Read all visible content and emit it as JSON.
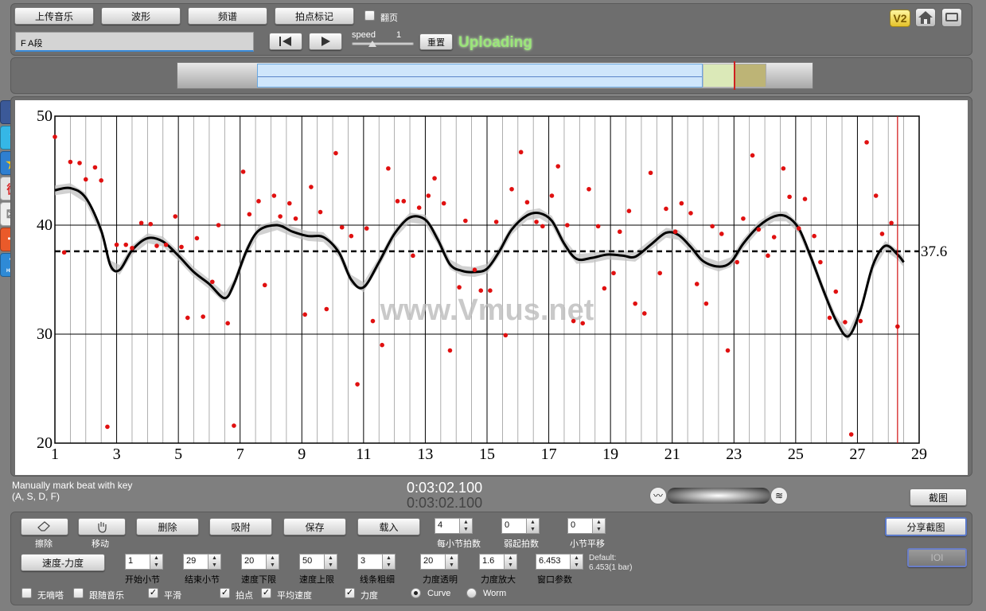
{
  "toolbar": {
    "upload_music": "上传音乐",
    "waveform": "波形",
    "spectrum": "频谱",
    "tap_marker": "拍点标记",
    "flip_page": "翻页",
    "segment_name": "F A段",
    "speed_label": "speed",
    "speed_value": "1",
    "reset": "重置",
    "status": "Uploading",
    "v2_badge": "V2"
  },
  "social": [
    "f",
    "t",
    "★",
    "微",
    "✉",
    "+",
    "?"
  ],
  "social_help": "HELP",
  "chart_data": {
    "type": "scatter",
    "x_ticks": [
      "1",
      "3",
      "5",
      "7",
      "9",
      "11",
      "13",
      "15",
      "17",
      "19",
      "21",
      "23",
      "25",
      "27",
      "29"
    ],
    "y_ticks": [
      "20",
      "30",
      "40",
      "50"
    ],
    "xlim": [
      1,
      29
    ],
    "ylim": [
      20,
      50
    ],
    "mean_line": 37.6,
    "mean_label": "37.6",
    "cursor_x": 28.3,
    "watermark": "www.Vmus.net",
    "points": [
      [
        1.0,
        48.1
      ],
      [
        1.3,
        37.5
      ],
      [
        1.5,
        45.8
      ],
      [
        1.8,
        45.7
      ],
      [
        2.0,
        44.2
      ],
      [
        2.3,
        45.3
      ],
      [
        2.5,
        44.1
      ],
      [
        2.7,
        21.5
      ],
      [
        3.0,
        38.2
      ],
      [
        3.3,
        38.2
      ],
      [
        3.5,
        37.9
      ],
      [
        3.8,
        40.2
      ],
      [
        4.1,
        40.1
      ],
      [
        4.3,
        38.1
      ],
      [
        4.6,
        38.2
      ],
      [
        4.9,
        40.8
      ],
      [
        5.1,
        38.0
      ],
      [
        5.3,
        31.5
      ],
      [
        5.6,
        38.8
      ],
      [
        5.8,
        31.6
      ],
      [
        6.1,
        34.8
      ],
      [
        6.3,
        40.0
      ],
      [
        6.6,
        31.0
      ],
      [
        6.8,
        21.6
      ],
      [
        7.1,
        44.9
      ],
      [
        7.3,
        41.0
      ],
      [
        7.6,
        42.2
      ],
      [
        7.8,
        34.5
      ],
      [
        8.1,
        42.7
      ],
      [
        8.3,
        40.8
      ],
      [
        8.6,
        42.0
      ],
      [
        8.8,
        40.6
      ],
      [
        9.1,
        31.8
      ],
      [
        9.3,
        43.5
      ],
      [
        9.6,
        41.2
      ],
      [
        9.8,
        32.3
      ],
      [
        10.1,
        46.6
      ],
      [
        10.3,
        39.8
      ],
      [
        10.6,
        39.0
      ],
      [
        10.8,
        25.4
      ],
      [
        11.1,
        39.7
      ],
      [
        11.3,
        31.2
      ],
      [
        11.6,
        29.0
      ],
      [
        11.8,
        45.2
      ],
      [
        12.1,
        42.2
      ],
      [
        12.3,
        42.2
      ],
      [
        12.6,
        37.2
      ],
      [
        12.8,
        41.6
      ],
      [
        13.1,
        42.7
      ],
      [
        13.3,
        44.3
      ],
      [
        13.6,
        42.0
      ],
      [
        13.8,
        28.5
      ],
      [
        14.1,
        34.3
      ],
      [
        14.3,
        40.4
      ],
      [
        14.6,
        35.9
      ],
      [
        14.8,
        34.0
      ],
      [
        15.1,
        34.0
      ],
      [
        15.3,
        40.3
      ],
      [
        15.6,
        29.9
      ],
      [
        15.8,
        43.3
      ],
      [
        16.1,
        46.7
      ],
      [
        16.3,
        42.1
      ],
      [
        16.6,
        40.3
      ],
      [
        16.8,
        39.9
      ],
      [
        17.1,
        42.7
      ],
      [
        17.3,
        45.4
      ],
      [
        17.6,
        40.0
      ],
      [
        17.8,
        31.2
      ],
      [
        18.1,
        31.0
      ],
      [
        18.3,
        43.3
      ],
      [
        18.6,
        39.9
      ],
      [
        18.8,
        34.2
      ],
      [
        19.1,
        35.6
      ],
      [
        19.3,
        39.4
      ],
      [
        19.6,
        41.3
      ],
      [
        19.8,
        32.8
      ],
      [
        20.1,
        31.9
      ],
      [
        20.3,
        44.8
      ],
      [
        20.6,
        35.6
      ],
      [
        20.8,
        41.5
      ],
      [
        21.1,
        39.4
      ],
      [
        21.3,
        42.0
      ],
      [
        21.6,
        41.1
      ],
      [
        21.8,
        34.6
      ],
      [
        22.1,
        32.8
      ],
      [
        22.3,
        39.9
      ],
      [
        22.6,
        39.2
      ],
      [
        22.8,
        28.5
      ],
      [
        23.1,
        36.6
      ],
      [
        23.3,
        40.6
      ],
      [
        23.6,
        46.4
      ],
      [
        23.8,
        39.6
      ],
      [
        24.1,
        37.2
      ],
      [
        24.3,
        38.9
      ],
      [
        24.6,
        45.2
      ],
      [
        24.8,
        42.6
      ],
      [
        25.1,
        39.7
      ],
      [
        25.3,
        42.4
      ],
      [
        25.6,
        39.0
      ],
      [
        25.8,
        36.6
      ],
      [
        26.1,
        31.5
      ],
      [
        26.3,
        33.9
      ],
      [
        26.6,
        31.1
      ],
      [
        26.8,
        20.8
      ],
      [
        27.1,
        31.2
      ],
      [
        27.3,
        47.6
      ],
      [
        27.6,
        42.7
      ],
      [
        27.8,
        39.2
      ],
      [
        28.1,
        40.2
      ],
      [
        28.3,
        30.7
      ]
    ],
    "curve": [
      [
        1.0,
        43.2
      ],
      [
        1.5,
        43.4
      ],
      [
        2.0,
        42.5
      ],
      [
        2.5,
        39.5
      ],
      [
        2.8,
        36.3
      ],
      [
        3.1,
        35.9
      ],
      [
        3.5,
        37.7
      ],
      [
        4.0,
        38.8
      ],
      [
        4.5,
        38.5
      ],
      [
        5.0,
        37.2
      ],
      [
        5.5,
        35.7
      ],
      [
        6.0,
        34.6
      ],
      [
        6.5,
        33.3
      ],
      [
        6.8,
        34.6
      ],
      [
        7.2,
        37.6
      ],
      [
        7.6,
        39.5
      ],
      [
        8.2,
        40.0
      ],
      [
        8.7,
        39.4
      ],
      [
        9.2,
        39.0
      ],
      [
        9.7,
        38.9
      ],
      [
        10.2,
        37.5
      ],
      [
        10.6,
        35.0
      ],
      [
        11.0,
        34.3
      ],
      [
        11.5,
        36.6
      ],
      [
        12.0,
        39.2
      ],
      [
        12.5,
        40.7
      ],
      [
        13.0,
        40.5
      ],
      [
        13.4,
        38.7
      ],
      [
        13.8,
        36.4
      ],
      [
        14.2,
        35.8
      ],
      [
        14.6,
        35.7
      ],
      [
        15.0,
        36.0
      ],
      [
        15.4,
        37.6
      ],
      [
        15.8,
        39.6
      ],
      [
        16.3,
        40.9
      ],
      [
        16.7,
        41.1
      ],
      [
        17.1,
        40.4
      ],
      [
        17.5,
        38.3
      ],
      [
        17.9,
        36.9
      ],
      [
        18.4,
        37.0
      ],
      [
        18.9,
        37.3
      ],
      [
        19.4,
        37.2
      ],
      [
        19.8,
        37.1
      ],
      [
        20.3,
        38.2
      ],
      [
        20.8,
        39.3
      ],
      [
        21.2,
        39.1
      ],
      [
        21.6,
        38.0
      ],
      [
        22.0,
        36.7
      ],
      [
        22.5,
        36.2
      ],
      [
        22.9,
        36.6
      ],
      [
        23.3,
        38.3
      ],
      [
        23.8,
        39.9
      ],
      [
        24.3,
        40.8
      ],
      [
        24.7,
        40.8
      ],
      [
        25.1,
        39.7
      ],
      [
        25.5,
        37.0
      ],
      [
        25.9,
        34.0
      ],
      [
        26.3,
        31.3
      ],
      [
        26.7,
        29.8
      ],
      [
        27.1,
        32.2
      ],
      [
        27.5,
        36.3
      ],
      [
        27.9,
        38.1
      ],
      [
        28.3,
        37.3
      ],
      [
        28.5,
        36.6
      ]
    ]
  },
  "transport": {
    "hint_line1": "Manually mark beat with key",
    "hint_line2": "(A, S, D, F)",
    "time_current": "0:03:02.100",
    "time_total": "0:03:02.100",
    "screenshot": "截图"
  },
  "controls": {
    "erase": "擦除",
    "move": "移动",
    "delete": "删除",
    "snap": "吸附",
    "save": "保存",
    "load": "载入",
    "beats_per_bar_label": "每小节拍数",
    "beats_per_bar": "4",
    "pickup_label": "弱起拍数",
    "pickup": "0",
    "bar_shift_label": "小节平移",
    "bar_shift": "0",
    "share_screenshot": "分享截图",
    "ioi": "IOI",
    "tempo_dynamics": "速度-力度",
    "start_bar_label": "开始小节",
    "start_bar": "1",
    "end_bar_label": "结束小节",
    "end_bar": "29",
    "tempo_min_label": "速度下限",
    "tempo_min": "20",
    "tempo_max_label": "速度上限",
    "tempo_max": "50",
    "line_width_label": "线条粗细",
    "line_width": "3",
    "dyn_alpha_label": "力度透明",
    "dyn_alpha": "20",
    "dyn_scale_label": "力度放大",
    "dyn_scale": "1.6",
    "window_label": "窗口参数",
    "window": "6.453",
    "default_line1": "Default:",
    "default_line2": "6.453(1 bar)",
    "metronome": "无嘀嗒",
    "follow_music": "跟随音乐",
    "smooth": "平滑",
    "beats": "拍点",
    "avg_tempo": "平均速度",
    "dynamics": "力度",
    "curve": "Curve",
    "worm": "Worm"
  }
}
